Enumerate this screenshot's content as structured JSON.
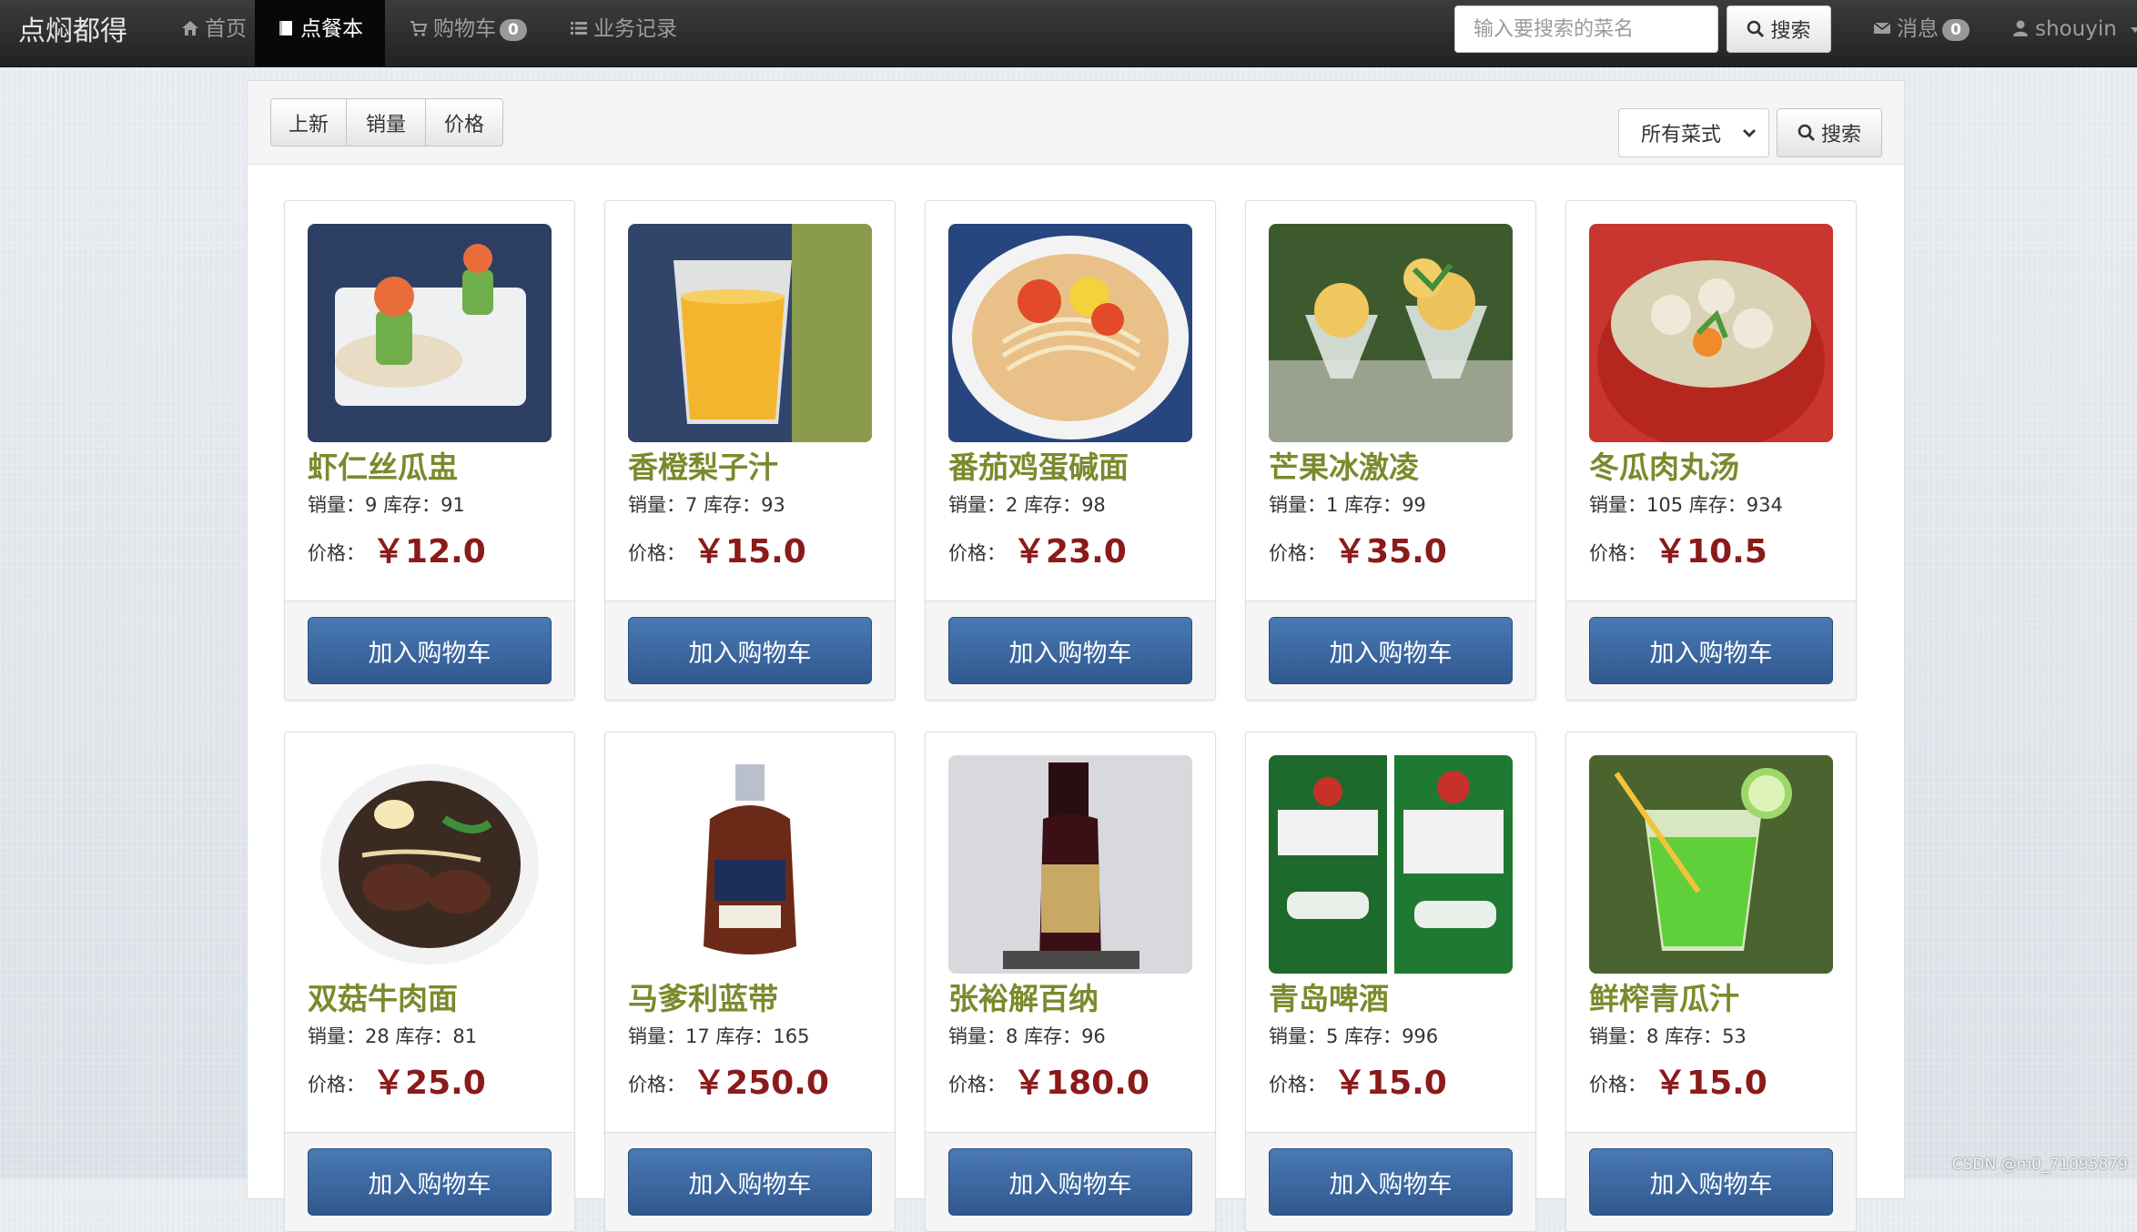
{
  "nav": {
    "brand": "点焖都得",
    "items": [
      {
        "label": "首页",
        "icon": "home-icon"
      },
      {
        "label": "点餐本",
        "icon": "book-icon",
        "active": true
      },
      {
        "label": "购物车",
        "icon": "cart-icon",
        "badge": "0"
      },
      {
        "label": "业务记录",
        "icon": "list-icon"
      }
    ],
    "search_placeholder": "输入要搜索的菜名",
    "search_label": "搜索",
    "messages_label": "消息",
    "messages_badge": "0",
    "user_label": "shouyin"
  },
  "toolbar": {
    "sort_buttons": [
      "上新",
      "销量",
      "价格"
    ],
    "cuisine_selected": "所有菜式",
    "search_label": "搜索"
  },
  "product_labels": {
    "sales": "销量：",
    "stock": "库存：",
    "price": "价格：",
    "currency": "￥",
    "add_to_cart": "加入购物车"
  },
  "products": [
    {
      "name": "虾仁丝瓜盅",
      "sales": "9",
      "stock": "91",
      "price": "12.0"
    },
    {
      "name": "香橙梨子汁",
      "sales": "7",
      "stock": "93",
      "price": "15.0"
    },
    {
      "name": "番茄鸡蛋碱面",
      "sales": "2",
      "stock": "98",
      "price": "23.0"
    },
    {
      "name": "芒果冰激凌",
      "sales": "1",
      "stock": "99",
      "price": "35.0"
    },
    {
      "name": "冬瓜肉丸汤",
      "sales": "105",
      "stock": "934",
      "price": "10.5"
    },
    {
      "name": "双菇牛肉面",
      "sales": "28",
      "stock": "81",
      "price": "25.0"
    },
    {
      "name": "马爹利蓝带",
      "sales": "17",
      "stock": "165",
      "price": "250.0"
    },
    {
      "name": "张裕解百纳",
      "sales": "8",
      "stock": "96",
      "price": "180.0"
    },
    {
      "name": "青岛啤酒",
      "sales": "5",
      "stock": "996",
      "price": "15.0"
    },
    {
      "name": "鲜榨青瓜汁",
      "sales": "8",
      "stock": "53",
      "price": "15.0"
    }
  ],
  "watermark": "CSDN @m0_71095879",
  "colors": {
    "navbar": "#222222",
    "dish_name": "#7a8a2c",
    "price": "#8b1a1a",
    "cart_button": "#3a659f"
  }
}
